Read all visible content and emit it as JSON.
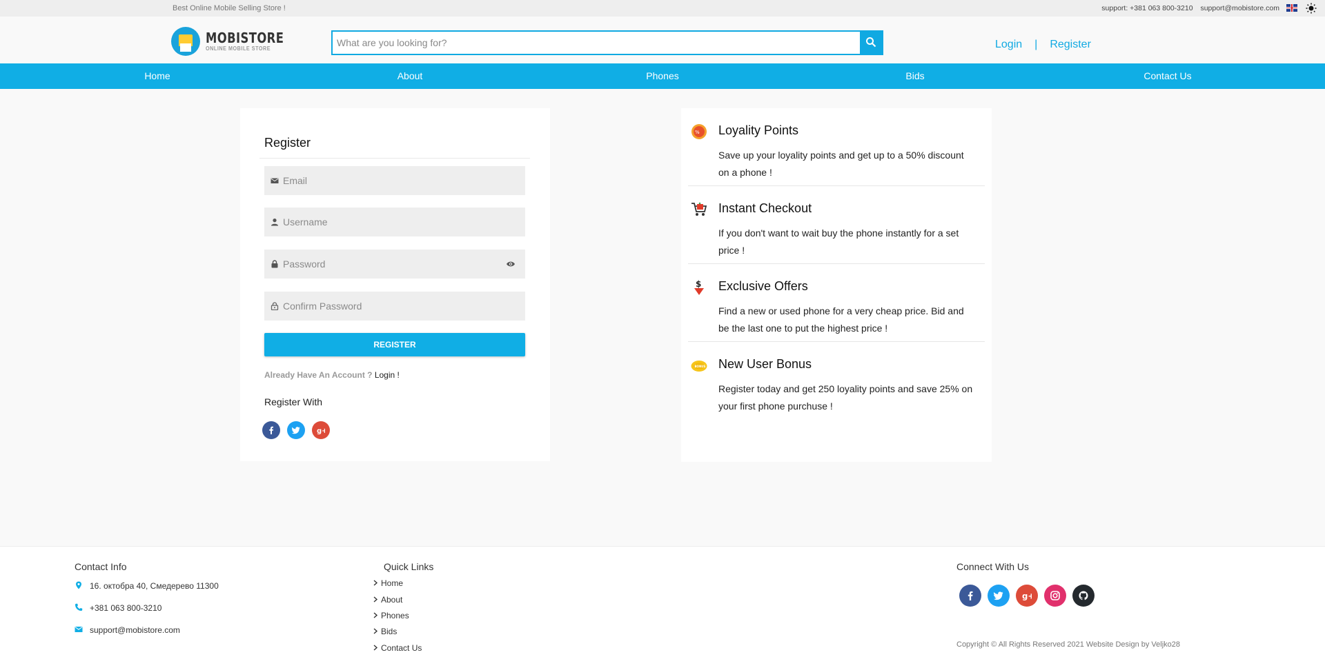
{
  "topbar": {
    "tagline": "Best Online Mobile Selling Store !",
    "support_phone": "support: +381 063 800-3210",
    "support_email": "support@mobistore.com"
  },
  "header": {
    "logo_name": "MOBISTORE",
    "logo_sub": "ONLINE MOBILE STORE",
    "search_placeholder": "What are you looking for?",
    "login": "Login",
    "separator": "|",
    "register": "Register"
  },
  "nav": {
    "items": [
      "Home",
      "About",
      "Phones",
      "Bids",
      "Contact Us"
    ]
  },
  "register_form": {
    "title": "Register",
    "email_placeholder": "Email",
    "username_placeholder": "Username",
    "password_placeholder": "Password",
    "confirm_placeholder": "Confirm Password",
    "submit": "REGISTER",
    "have_account": "Already Have An Account ?",
    "login_link": "Login !",
    "register_with": "Register With"
  },
  "benefits": [
    {
      "title": "Loyality Points",
      "desc": "Save up your loyality points and get up to a 50% discount on a phone !"
    },
    {
      "title": "Instant Checkout",
      "desc": "If you don't want to wait buy the phone instantly for a set price !"
    },
    {
      "title": "Exclusive Offers",
      "desc": "Find a new or used phone for a very cheap price. Bid and be the last one to put the highest price !"
    },
    {
      "title": "New User Bonus",
      "desc": "Register today and get 250 loyality points and save 25% on your first phone purchuse !"
    }
  ],
  "footer": {
    "contact_title": "Contact Info",
    "address": "16. октобра 40, Смедерево 11300",
    "phone": "+381 063 800-3210",
    "email": "support@mobistore.com",
    "quick_title": "Quick Links",
    "quick_links": [
      "Home",
      "About",
      "Phones",
      "Bids",
      "Contact Us"
    ],
    "connect_title": "Connect With Us",
    "copyright": "Copyright © All Rights Reserved 2021 Website Design by Veljko28"
  },
  "colors": {
    "accent": "#10aee5",
    "facebook": "#3b5998",
    "twitter": "#1da1f2",
    "google": "#dd4b39",
    "instagram": "#e1306c",
    "github": "#24292e"
  }
}
